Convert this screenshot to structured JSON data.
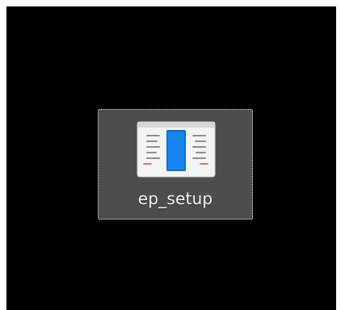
{
  "desktop": {
    "background_color": "#000000",
    "selected_icon": {
      "icon": "setup-window-icon",
      "label": "ep_setup"
    }
  },
  "colors": {
    "selection_fill": "#4d4d4d",
    "selection_border": "#d9d9d9",
    "icon_accent": "#0b6fd6"
  }
}
